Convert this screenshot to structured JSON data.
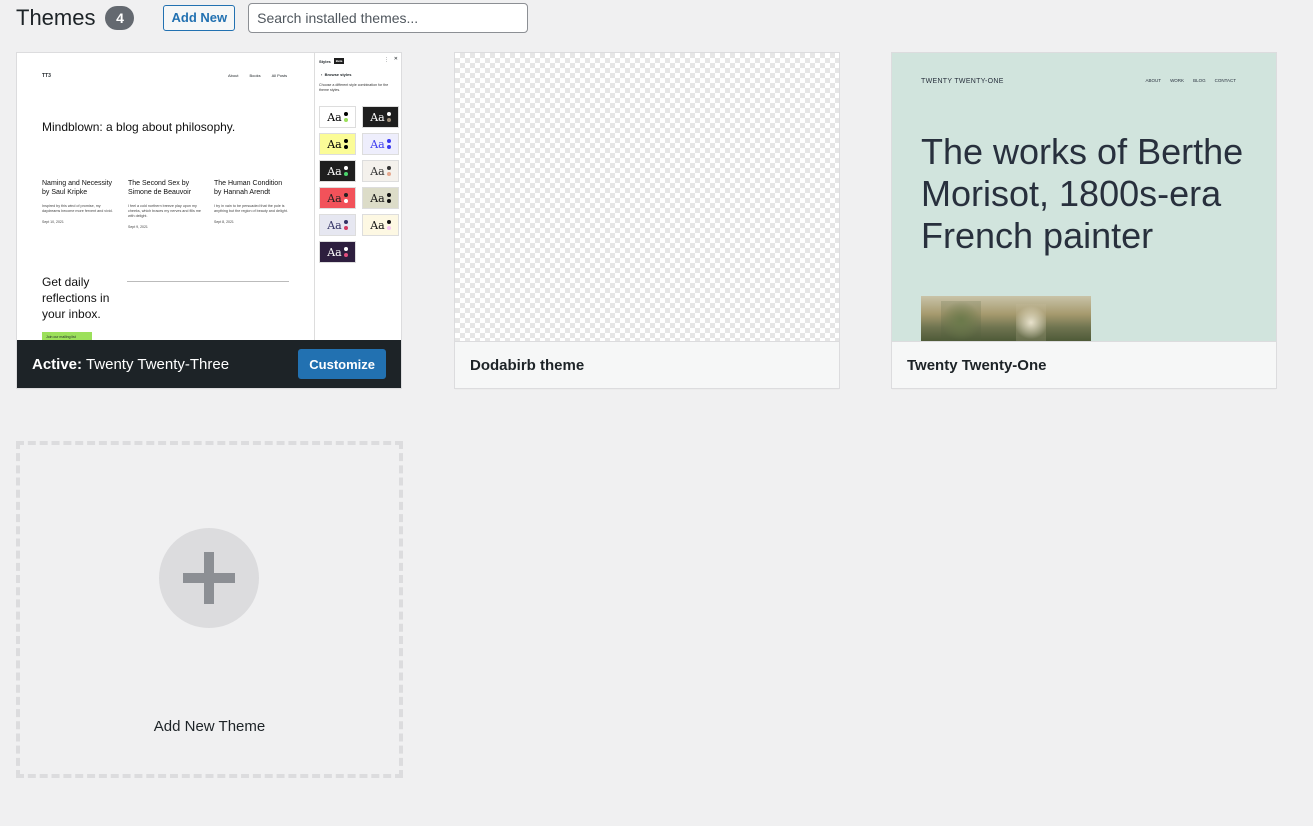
{
  "header": {
    "title": "Themes",
    "count": "4",
    "add_new_label": "Add New",
    "search_placeholder": "Search installed themes..."
  },
  "themes": [
    {
      "name": "Twenty Twenty-Three",
      "active_prefix": "Active:",
      "customize_label": "Customize",
      "preview": {
        "logo": "TT3",
        "nav": [
          "About",
          "Books",
          "All Posts"
        ],
        "title": "Mindblown: a blog about philosophy.",
        "posts": [
          {
            "title": "Naming and Necessity by Saul Kripke",
            "text": "Inspired by this wind of promise, my daydreams become more fervent and vivid.",
            "date": "Sept 10, 2021"
          },
          {
            "title": "The Second Sex by Simone de Beauvoir",
            "text": "I feel a cold northern breeze play upon my cheeks, which braces my nerves and fills me with delight.",
            "date": "Sept 9, 2021"
          },
          {
            "title": "The Human Condition by Hannah Arendt",
            "text": "I try in vain to be persuaded that the pole is anything but the region of beauty and delight.",
            "date": "Sept 8, 2021"
          }
        ],
        "cta": "Get daily reflections in your inbox.",
        "cta_button": "Join our mailing list",
        "panel_title": "Styles",
        "panel_badge": "Beta",
        "panel_back": "Browse styles",
        "panel_desc": "Choose a different style combination for the theme styles.",
        "swatch_text": "Aa"
      }
    },
    {
      "name": "Dodabirb theme"
    },
    {
      "name": "Twenty Twenty-One",
      "preview": {
        "site": "TWENTY TWENTY-ONE",
        "nav": [
          "ABOUT",
          "WORK",
          "BLOG",
          "CONTACT"
        ],
        "headline": "The works of Berthe Morisot, 1800s-era French painter"
      }
    }
  ],
  "add_new_theme_label": "Add New Theme",
  "swatches": [
    {
      "bg": "#ffffff",
      "fg": "#000000",
      "d1": "#000000",
      "d2": "#9ce05b"
    },
    {
      "bg": "#1e1e1e",
      "fg": "#ffffff",
      "d1": "#ffffff",
      "d2": "#9e8e7a"
    },
    {
      "bg": "#fbfc97",
      "fg": "#000000",
      "d1": "#000000",
      "d2": "#000000"
    },
    {
      "bg": "#eeeefc",
      "fg": "#3b3bf0",
      "d1": "#3b3bf0",
      "d2": "#3b3bf0"
    },
    {
      "bg": "#1e1e1e",
      "fg": "#ffffff",
      "d1": "#ffffff",
      "d2": "#4ad36b"
    },
    {
      "bg": "#f4f1ec",
      "fg": "#333333",
      "d1": "#333333",
      "d2": "#e5a88f"
    },
    {
      "bg": "#f2525a",
      "fg": "#222222",
      "d1": "#222222",
      "d2": "#ffffff"
    },
    {
      "bg": "#dcdcc8",
      "fg": "#111111",
      "d1": "#111111",
      "d2": "#111111"
    },
    {
      "bg": "#e6e7f1",
      "fg": "#333366",
      "d1": "#333366",
      "d2": "#d23c62"
    },
    {
      "bg": "#fdf8e3",
      "fg": "#111111",
      "d1": "#111111",
      "d2": "#f7c5f0"
    },
    {
      "bg": "#2d1e3e",
      "fg": "#ffffff",
      "d1": "#ffffff",
      "d2": "#e24e7e"
    }
  ]
}
